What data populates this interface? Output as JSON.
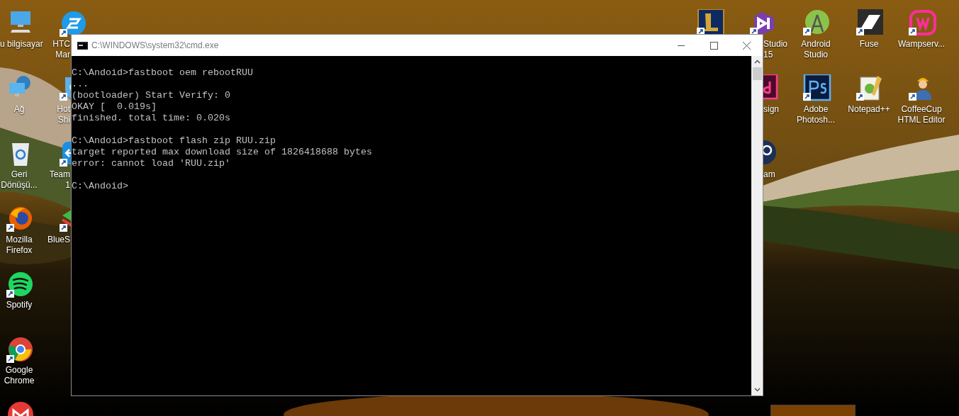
{
  "desktop": {
    "icons": [
      {
        "kind": "computer",
        "label": "u bilgisayar"
      },
      {
        "kind": "network",
        "label": "Ağ"
      },
      {
        "kind": "recycle",
        "label": "Geri Dönüşü..."
      },
      {
        "kind": "firefox",
        "label": "Mozilla Firefox"
      },
      {
        "kind": "spotify",
        "label": "Spotify"
      },
      {
        "kind": "chrome",
        "label": "Google Chrome"
      },
      {
        "kind": "gmail"
      },
      {
        "kind": "htc",
        "label": "HTC Mar"
      },
      {
        "kind": "hotspot",
        "label": "Hot Shi"
      },
      {
        "kind": "teamviewer",
        "label": "Team 1"
      },
      {
        "kind": "bluestacks",
        "label": "BlueS"
      },
      {
        "kind": "lol"
      },
      {
        "kind": "visualstudio",
        "label": "Studio 15"
      },
      {
        "kind": "android",
        "label": "Android Studio"
      },
      {
        "kind": "fuse",
        "label": "Fuse"
      },
      {
        "kind": "wamp",
        "label": "Wampserv..."
      },
      {
        "kind": "indesign",
        "label": "sign"
      },
      {
        "kind": "photoshop",
        "label": "Adobe Photosh..."
      },
      {
        "kind": "notepad",
        "label": "Notepad++"
      },
      {
        "kind": "coffeecup",
        "label": "CoffeeCup HTML Editor"
      },
      {
        "kind": "steam",
        "label": "am"
      }
    ]
  },
  "window": {
    "title": "C:\\WINDOWS\\system32\\cmd.exe",
    "console_blocks": [
      [
        "C:\\Andoid>fastboot oem rebootRUU",
        "...",
        "(bootloader) Start Verify: 0",
        "OKAY [  0.019s]",
        "finished. total time: 0.020s"
      ],
      [
        "C:\\Andoid>fastboot flash zip RUU.zip",
        "target reported max download size of 1826418688 bytes",
        "error: cannot load 'RUU.zip'"
      ],
      [
        "C:\\Andoid>"
      ]
    ]
  }
}
